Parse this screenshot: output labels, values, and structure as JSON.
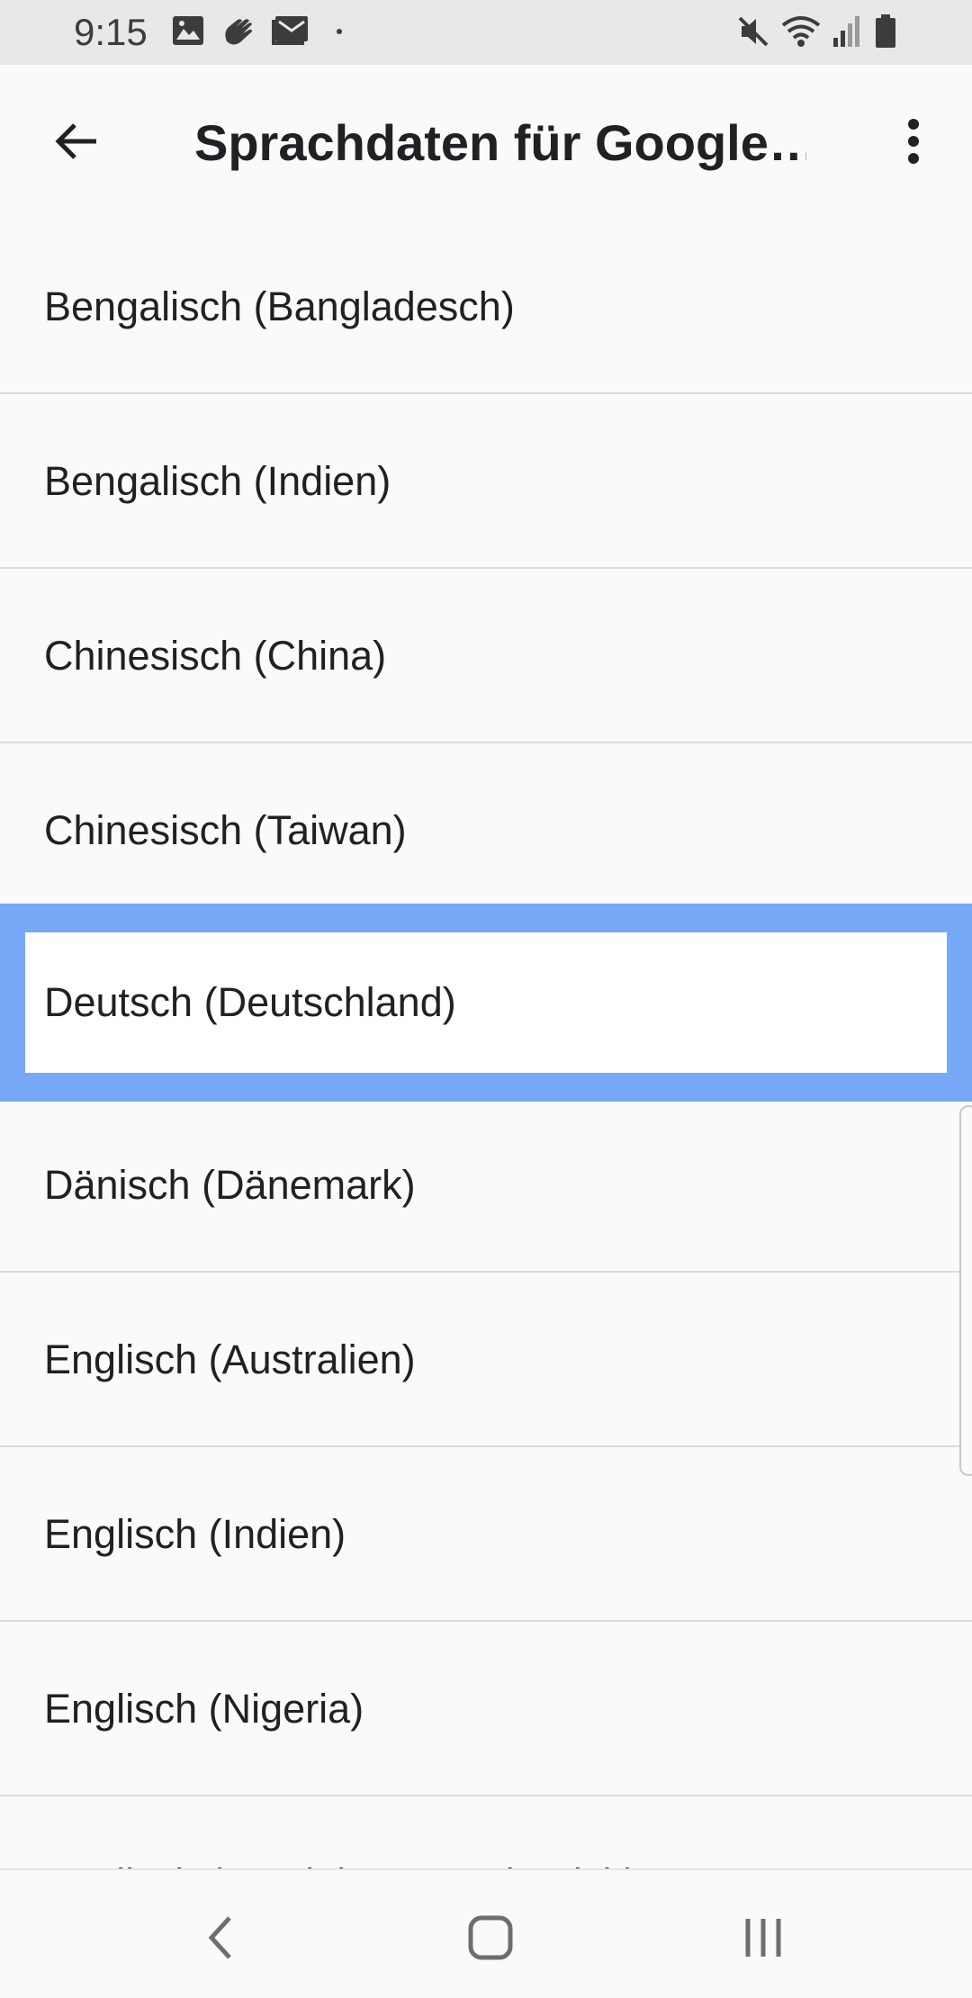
{
  "status_bar": {
    "time": "9:15",
    "left_icons": [
      "image-icon",
      "hand-wave-icon",
      "mail-icon",
      "dot-icon"
    ],
    "right_icons": [
      "mute-icon",
      "wifi-icon",
      "signal-icon",
      "battery-icon"
    ]
  },
  "app_bar": {
    "title": "Sprachdaten für Google…",
    "back_icon": "arrow-back-icon",
    "more_icon": "more-vert-icon"
  },
  "languages": [
    "Bengalisch (Bangladesch)",
    "Bengalisch (Indien)",
    "Chinesisch (China)",
    "Chinesisch (Taiwan)",
    "Deutsch (Deutschland)",
    "Dänisch (Dänemark)",
    "Englisch (Australien)",
    "Englisch (Indien)",
    "Englisch (Nigeria)",
    "Englisch (Vereinigtes Königreich)"
  ],
  "focused_language": "Deutsch (Deutschland)",
  "colors": {
    "focus_highlight": "#78a8f8",
    "background": "#fafafa",
    "status_bar": "#e8e8e8"
  },
  "nav_bar": {
    "buttons": [
      "back-nav-icon",
      "home-icon",
      "recents-icon"
    ]
  }
}
